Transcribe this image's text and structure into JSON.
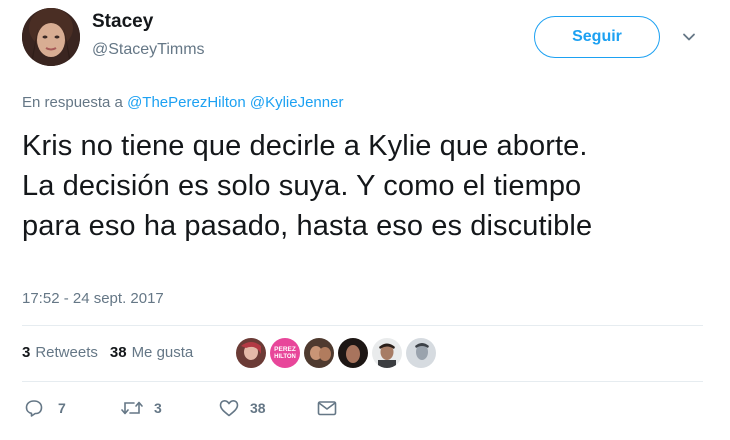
{
  "user": {
    "name": "Stacey",
    "handle": "@StaceyTimms"
  },
  "follow_button": "Seguir",
  "reply": {
    "prefix": "En respuesta a",
    "mentions": "@ThePerezHilton @KylieJenner"
  },
  "tweet_text": "Kris no tiene que decirle a Kylie que aborte.\nLa decisión es solo suya. Y como el tiempo\npara eso ha pasado, hasta eso es discutible",
  "timestamp": "17:52 - 24 sept. 2017",
  "stats": {
    "retweets_count": "3",
    "retweets_label": "Retweets",
    "likes_count": "38",
    "likes_label": "Me gusta",
    "liker_avatar_badge": "PEREZ HILTON"
  },
  "actions": {
    "reply_count": "7",
    "retweet_count": "3",
    "like_count": "38"
  },
  "colors": {
    "accent": "#1da1f2",
    "secondary_text": "#657786",
    "primary_text": "#14171a"
  }
}
